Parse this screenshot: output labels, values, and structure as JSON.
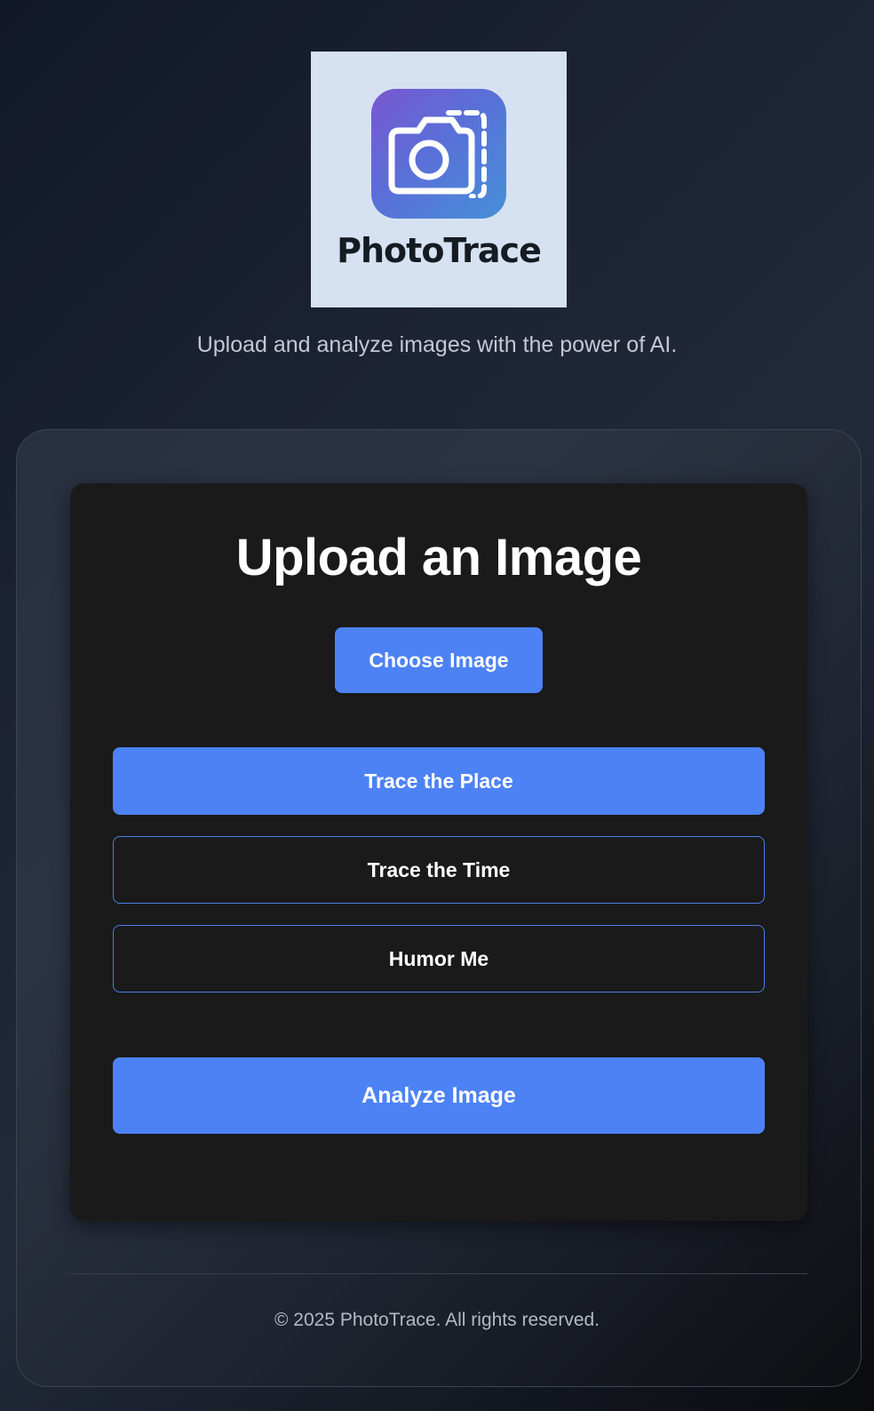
{
  "logo": {
    "wordmark": "PhotoTrace",
    "icon": "camera-icon"
  },
  "tagline": "Upload and analyze images with the power of AI.",
  "upload": {
    "title": "Upload an Image",
    "choose_label": "Choose Image",
    "modes": [
      {
        "label": "Trace the Place",
        "selected": true
      },
      {
        "label": "Trace the Time",
        "selected": false
      },
      {
        "label": "Humor Me",
        "selected": false
      }
    ],
    "analyze_label": "Analyze Image"
  },
  "footer": {
    "copyright": "© 2025 PhotoTrace. All rights reserved."
  },
  "colors": {
    "accent": "#4d82f5",
    "card_bg": "#1a1a1a",
    "logo_bg": "#d6e2f1"
  }
}
